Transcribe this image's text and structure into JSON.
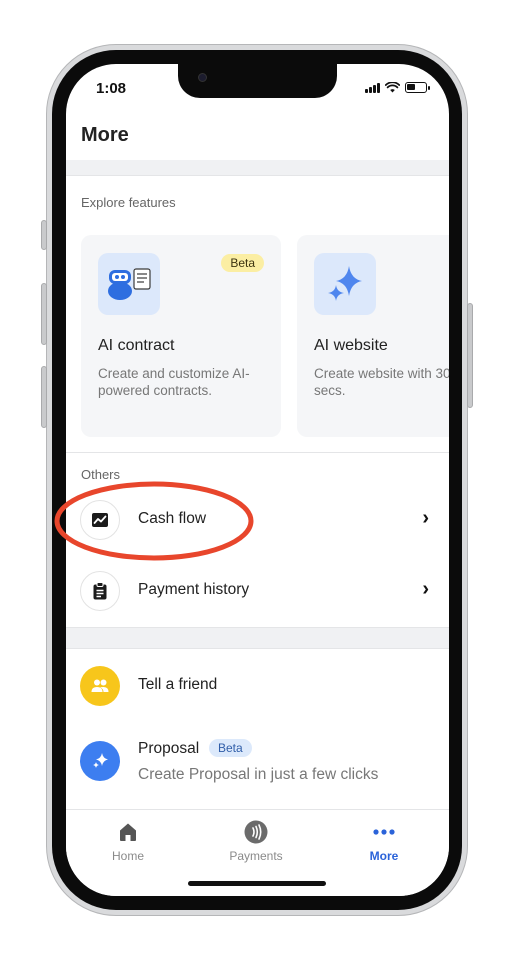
{
  "status_bar": {
    "time": "1:08"
  },
  "header": {
    "title": "More"
  },
  "explore": {
    "label": "Explore features",
    "cards": [
      {
        "title": "AI contract",
        "description": "Create and customize AI-powered contracts.",
        "badge": "Beta",
        "icon": "robot-contract-icon"
      },
      {
        "title": "AI website",
        "description": "Create website with 30 secs.",
        "icon": "sparkle-icon"
      }
    ]
  },
  "others": {
    "label": "Others",
    "items": [
      {
        "label": "Cash flow",
        "icon": "chart-icon"
      },
      {
        "label": "Payment history",
        "icon": "clipboard-icon"
      }
    ]
  },
  "extras": {
    "tell_friend": {
      "label": "Tell a friend",
      "icon": "people-icon",
      "color": "#f7c61b"
    },
    "proposal": {
      "label": "Proposal",
      "badge": "Beta",
      "subtitle": "Create Proposal in just a few clicks",
      "icon": "sparkle-icon",
      "color": "#3d7ef0"
    }
  },
  "tabbar": {
    "tabs": [
      {
        "label": "Home",
        "icon": "home-icon",
        "active": false
      },
      {
        "label": "Payments",
        "icon": "contactless-icon",
        "active": false
      },
      {
        "label": "More",
        "icon": "more-dots-icon",
        "active": true
      }
    ]
  },
  "annotation": {
    "color": "#e8462c"
  }
}
